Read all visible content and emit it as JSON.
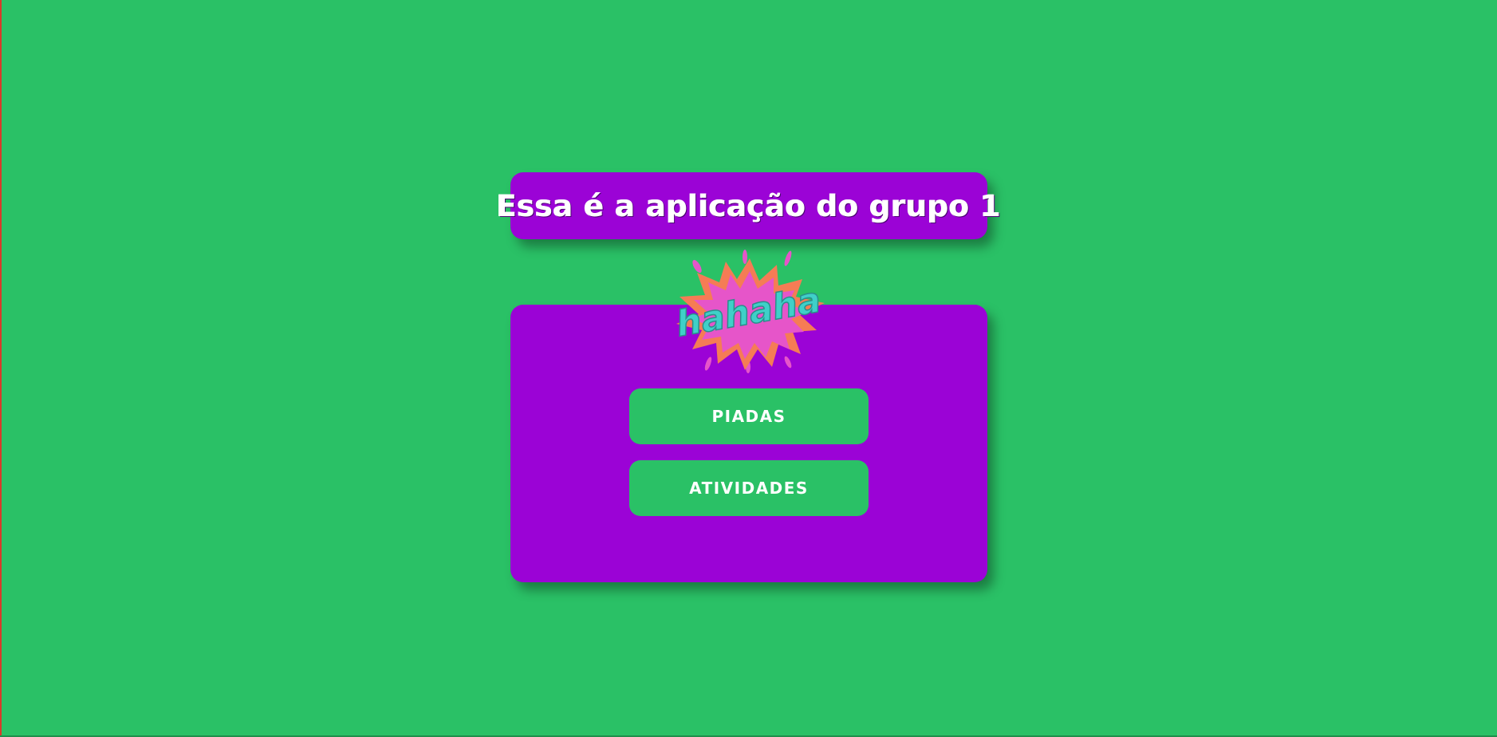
{
  "title": {
    "text": "Essa é a aplicação do grupo 1"
  },
  "logo": {
    "text": "hahaha",
    "icon": "hahaha-burst-icon"
  },
  "menu": {
    "buttons": [
      {
        "label": "PIADAS"
      },
      {
        "label": "ATIVIDADES"
      }
    ]
  },
  "colors": {
    "background": "#2ac166",
    "card": "#9b03d6",
    "button": "#2ac166",
    "text": "#ffffff",
    "burst_outer": "#f57c55",
    "burst_inner": "#e655c9",
    "burst_text": "#3fd0c8"
  }
}
